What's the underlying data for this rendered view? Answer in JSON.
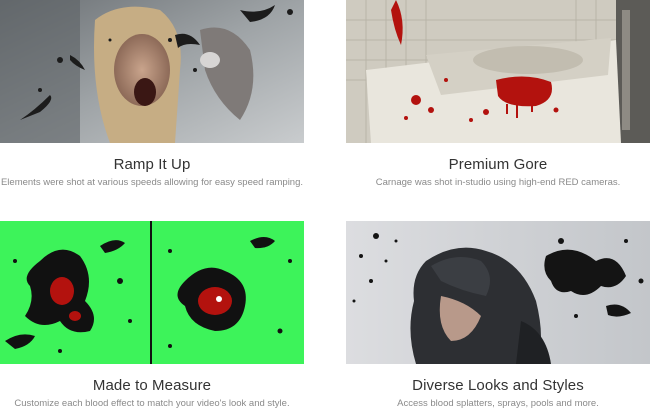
{
  "features": [
    {
      "title": "Ramp It Up",
      "caption": "Elements were shot at various speeds allowing for easy speed ramping.",
      "image": "screaming-woman-blood-splatter-image"
    },
    {
      "title": "Premium Gore",
      "caption": "Carnage was shot in-studio using high-end RED cameras.",
      "image": "bloody-bathtub-image"
    },
    {
      "title": "Made to Measure",
      "caption": "Customize each blood effect to match your video's look and style.",
      "image": "green-screen-blood-image"
    },
    {
      "title": "Diverse Looks and Styles",
      "caption": "Access blood splatters, sprays, pools and more.",
      "image": "hooded-figure-wall-splatter-image"
    }
  ],
  "colors": {
    "title": "#333333",
    "caption": "#8a8a8a",
    "greenscreen": "#3df35a",
    "blood": "#b3120e"
  }
}
